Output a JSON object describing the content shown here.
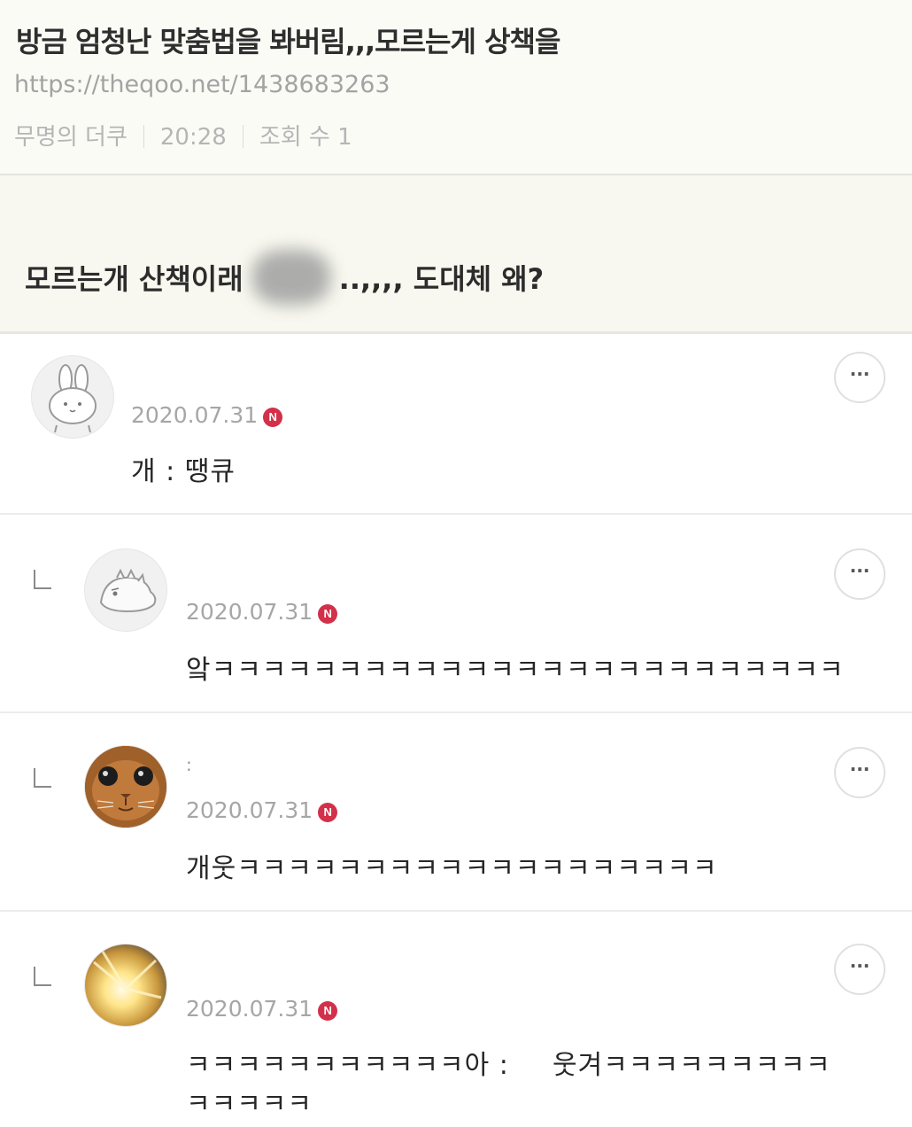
{
  "post": {
    "title": "방금 엄청난 맞춤법을 봐버림,,,모르는게 상책을",
    "url": "https://theqoo.net/1438683263",
    "author": "무명의 더쿠",
    "time": "20:28",
    "views": "조회 수 1",
    "content_before": "모르는개 산책이래",
    "content_after": "..,,,, 도대체 왜?"
  },
  "comments": [
    {
      "date": "2020.07.31",
      "badge": "N",
      "text": "개 : 땡큐",
      "more": "···",
      "avatar": "rabbit-avatar"
    },
    {
      "date": "2020.07.31",
      "badge": "N",
      "text": "앜ㅋㅋㅋㅋㅋㅋㅋㅋㅋㅋㅋㅋㅋㅋㅋㅋㅋㅋㅋㅋㅋㅋㅋㅋㅋ",
      "more": "···",
      "avatar": "dinosaur-avatar"
    },
    {
      "date": "2020.07.31",
      "badge": "N",
      "nick": ":",
      "text": "개웃ㅋㅋㅋㅋㅋㅋㅋㅋㅋㅋㅋㅋㅋㅋㅋㅋㅋㅋㅋ",
      "more": "···",
      "avatar": "cat-avatar"
    },
    {
      "date": "2020.07.31",
      "badge": "N",
      "text_line1a": "ㅋㅋㅋㅋㅋㅋㅋㅋㅋㅋㅋ아 :",
      "text_line1b": "웃겨ㅋㅋㅋㅋㅋㅋㅋㅋㅋ",
      "text_line2": "ㅋㅋㅋㅋㅋ",
      "more": "···",
      "avatar": "sunburst-avatar"
    }
  ]
}
